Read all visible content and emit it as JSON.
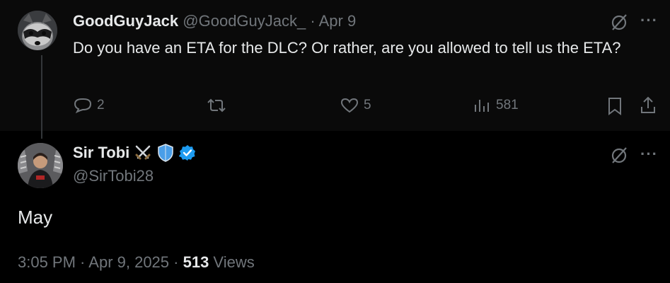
{
  "reply": {
    "author_name": "GoodGuyJack",
    "handle": "@GoodGuyJack_",
    "separator": " · ",
    "date": "Apr 9",
    "text": "Do you have an ETA for the DLC? Or rather, are you allowed to tell us the ETA?",
    "more_label": "···",
    "actions": {
      "reply_count": "2",
      "repost_count": "",
      "like_count": "5",
      "views_count": "581"
    }
  },
  "main_tweet": {
    "author_name": "Sir Tobi",
    "emojis": [
      "crossed-swords",
      "shield"
    ],
    "verified": true,
    "handle": "@SirTobi28",
    "more_label": "···",
    "text": "May",
    "time": "3:05 PM",
    "dot": " · ",
    "date": "Apr 9, 2025",
    "dot2": " · ",
    "views_count": "513",
    "views_label": " Views"
  },
  "colors": {
    "background": "#000000",
    "reply_background": "#0a0a0a",
    "text": "#e7e9ea",
    "muted": "#71767b",
    "verified_blue": "#1d9bf0"
  }
}
